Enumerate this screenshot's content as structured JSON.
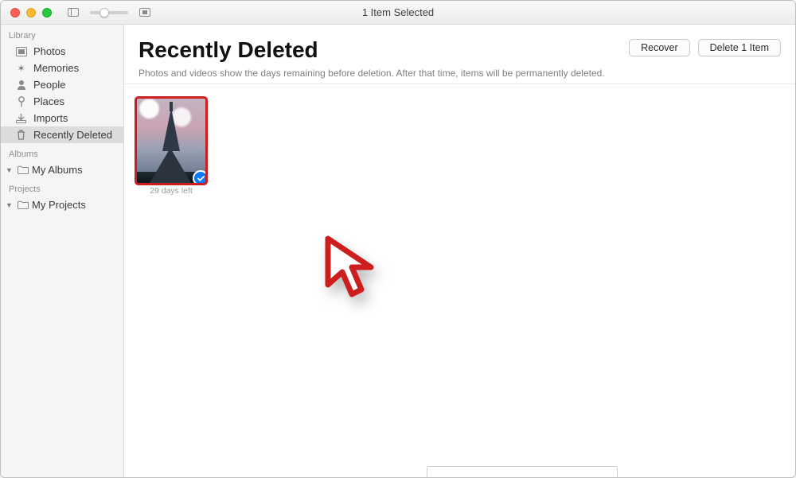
{
  "titlebar": {
    "title": "1 Item Selected"
  },
  "sidebar": {
    "sections": {
      "library_label": "Library",
      "albums_label": "Albums",
      "projects_label": "Projects"
    },
    "library": [
      {
        "label": "Photos",
        "icon": "photos-icon"
      },
      {
        "label": "Memories",
        "icon": "memories-icon"
      },
      {
        "label": "People",
        "icon": "people-icon"
      },
      {
        "label": "Places",
        "icon": "places-icon"
      },
      {
        "label": "Imports",
        "icon": "imports-icon"
      },
      {
        "label": "Recently Deleted",
        "icon": "trash-icon",
        "selected": true
      }
    ],
    "albums_group": {
      "label": "My Albums"
    },
    "projects_group": {
      "label": "My Projects"
    }
  },
  "main": {
    "heading": "Recently Deleted",
    "subtitle": "Photos and videos show the days remaining before deletion. After that time, items will be permanently deleted.",
    "buttons": {
      "recover": "Recover",
      "delete": "Delete 1 Item"
    },
    "items": [
      {
        "caption": "29 days left",
        "selected": true
      }
    ]
  }
}
